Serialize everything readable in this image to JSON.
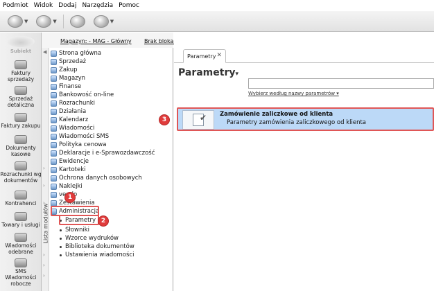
{
  "menu": [
    "Podmiot",
    "Widok",
    "Dodaj",
    "Narzędzia",
    "Pomoc"
  ],
  "toolbar": {
    "icons": [
      "printer-icon",
      "export-icon",
      "document-icon",
      "help-icon"
    ]
  },
  "sidebar": {
    "logo_text": "Subiekt",
    "items": [
      "Faktury sprzedaży",
      "Sprzedaż detaliczna",
      "Faktury zakupu",
      "Dokumenty kasowe",
      "Rozrachunki wg dokumentów",
      "Kontrahenci",
      "Towary i usługi",
      "Wiadomości odebrane",
      "SMS Wiadomości robocze"
    ]
  },
  "nav": {
    "warehouse": "Magazyn: - MAG - Główny",
    "no_lock": "Brak blokady",
    "strip_label": "Lista modułów",
    "tree": [
      "Strona główna",
      "Sprzedaż",
      "Zakup",
      "Magazyn",
      "Finanse",
      "Bankowość on-line",
      "Rozrachunki",
      "Działania",
      "Kalendarz",
      "Wiadomości",
      "Wiadomości SMS",
      "Polityka cenowa",
      "Deklaracje i e-Sprawozdawczość",
      "Ewidencje",
      "Kartoteki",
      "Ochrona danych osobowych",
      "Naklejki",
      "vendo",
      "Zestawienia",
      "Administracja"
    ],
    "sub": [
      "Parametry",
      "Słowniki",
      "Wzorce wydruków",
      "Biblioteka dokumentów",
      "Ustawienia wiadomości"
    ]
  },
  "content": {
    "tab": "Parametry",
    "title": "Parametry",
    "search_placeholder": "",
    "search_mode": "Wybierz według nazwy parametrów ▾",
    "result_title": "Zamówienie zaliczkowe od klienta",
    "result_desc": "Parametry zamówienia zaliczkowego od klienta"
  },
  "callouts": [
    "1",
    "2",
    "3"
  ],
  "colors": {
    "highlight": "#e05656",
    "selection": "#bcd9f7",
    "callout": "#e03c3c"
  }
}
